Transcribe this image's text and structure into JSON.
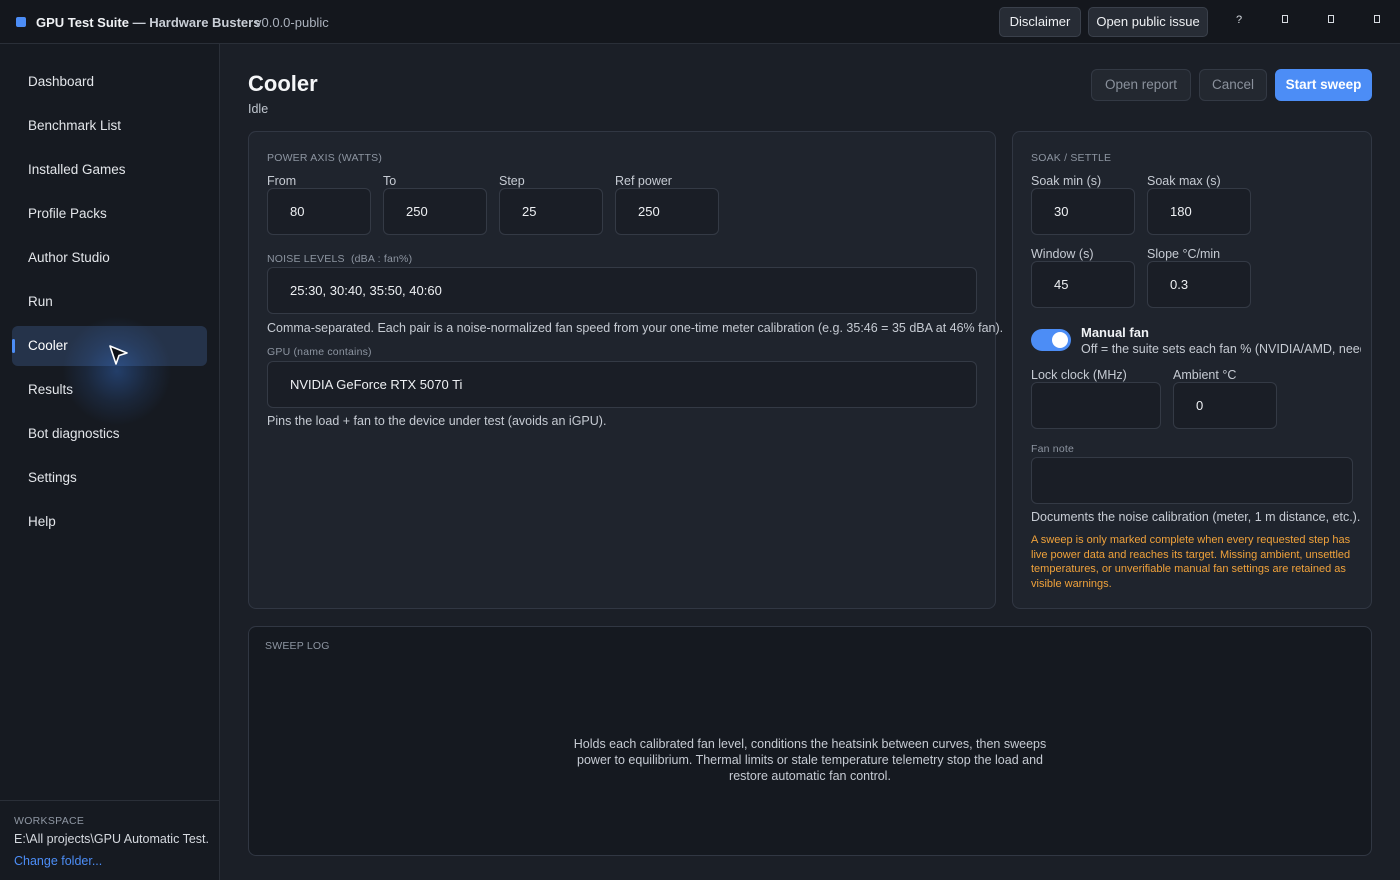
{
  "titlebar": {
    "app_name": "GPU Test Suite",
    "separator": " — ",
    "org": "Hardware Busters",
    "version": "v0.0.0-public",
    "disclaimer_label": "Disclaimer",
    "issue_label": "Open public issue",
    "help_glyph": "?"
  },
  "sidebar": {
    "items": [
      {
        "label": "Dashboard"
      },
      {
        "label": "Benchmark List"
      },
      {
        "label": "Installed Games"
      },
      {
        "label": "Profile Packs"
      },
      {
        "label": "Author Studio"
      },
      {
        "label": "Run"
      },
      {
        "label": "Cooler"
      },
      {
        "label": "Results"
      },
      {
        "label": "Bot diagnostics"
      },
      {
        "label": "Settings"
      },
      {
        "label": "Help"
      }
    ],
    "active": "Cooler",
    "workspace_label": "WORKSPACE",
    "workspace_path": "E:\\All projects\\GPU Automatic Test...",
    "change_folder": "Change folder..."
  },
  "header": {
    "title": "Cooler",
    "status": "Idle",
    "open_report": "Open report",
    "cancel": "Cancel",
    "start_sweep": "Start sweep"
  },
  "power": {
    "section": "POWER AXIS (WATTS)",
    "from_label": "From",
    "from_value": "80",
    "to_label": "To",
    "to_value": "250",
    "step_label": "Step",
    "step_value": "25",
    "ref_label": "Ref power",
    "ref_value": "250",
    "noise_section": "NOISE LEVELS",
    "noise_unit": "(dBA : fan%)",
    "noise_value": "25:30, 30:40, 35:50, 40:60",
    "noise_help": "Comma-separated. Each pair is a noise-normalized fan speed from your one-time meter calibration (e.g. 35:46 = 35 dBA at 46% fan).",
    "gpu_label": "GPU (name contains)",
    "gpu_value": "NVIDIA GeForce RTX 5070 Ti",
    "gpu_help": "Pins the load + fan to the device under test (avoids an iGPU)."
  },
  "soak": {
    "section": "SOAK / SETTLE",
    "soak_min_label": "Soak min (s)",
    "soak_min_value": "30",
    "soak_max_label": "Soak max (s)",
    "soak_max_value": "180",
    "window_label": "Window (s)",
    "window_value": "45",
    "slope_label": "Slope °C/min",
    "slope_value": "0.3",
    "manual_fan_title": "Manual fan",
    "manual_fan_on": true,
    "manual_fan_desc": "Off = the suite sets each fan % (NVIDIA/AMD, need",
    "lock_clock_label": "Lock clock (MHz)",
    "lock_clock_value": "",
    "ambient_label": "Ambient °C",
    "ambient_value": "0",
    "fan_note_label": "Fan note",
    "fan_note_value": "",
    "fan_note_help": "Documents the noise calibration (meter, 1 m distance, etc.).",
    "warning": "A sweep is only marked complete when every requested step has live power data and reaches its target. Missing ambient, unsettled temperatures, or unverifiable manual fan settings are retained as visible warnings."
  },
  "log": {
    "section": "SWEEP LOG",
    "empty_text": "Holds each calibrated fan level, conditions the heatsink between curves, then sweeps power to equilibrium. Thermal limits or stale temperature telemetry stop the load and restore automatic fan control."
  },
  "colors": {
    "accent": "#4c8df6",
    "warning": "#f0a23b",
    "background": "#1b1f27"
  }
}
